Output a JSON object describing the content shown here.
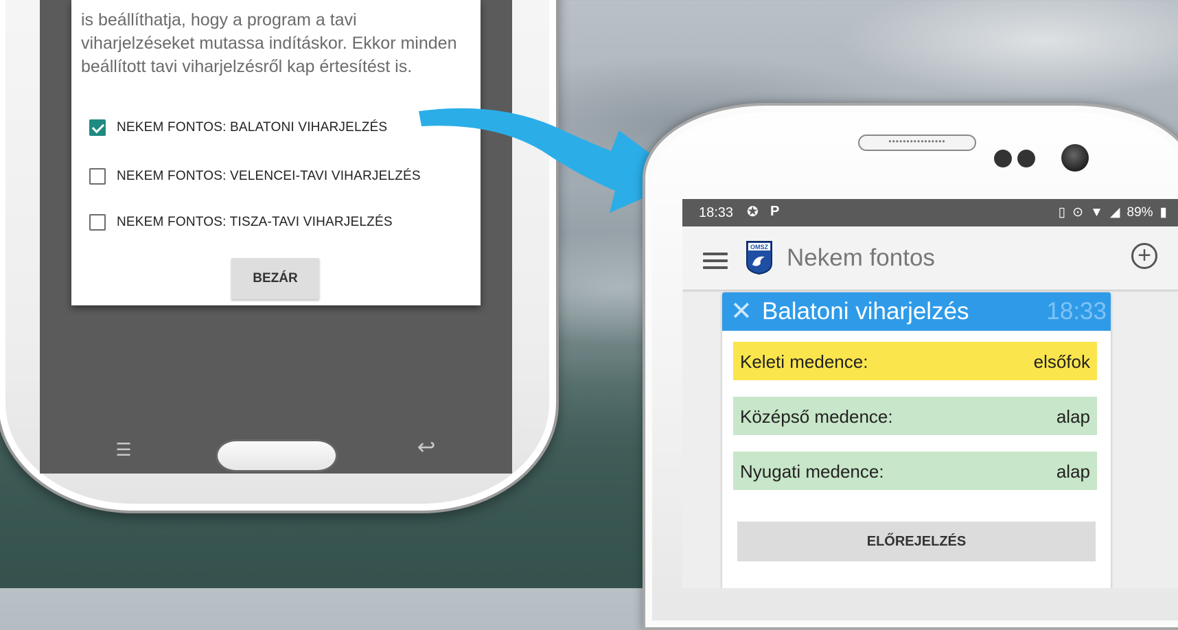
{
  "colors": {
    "checkbox_checked": "#1f8a82",
    "card_header": "#2f9be8",
    "card_time": "#7fc3f5",
    "arrow": "#2baee8",
    "row_warning": "#fbe54d",
    "row_basic": "#c8e6c9"
  },
  "left_phone": {
    "dialog_text": "is beállíthatja, hogy a program a tavi viharjelzéseket mutassa indításkor. Ekkor minden beállított tavi viharjelzésről kap értesítést is.",
    "options": [
      {
        "label": "NEKEM FONTOS: BALATONI VIHARJELZÉS",
        "checked": true
      },
      {
        "label": "NEKEM FONTOS: VELENCEI-TAVI VIHARJELZÉS",
        "checked": false
      },
      {
        "label": "NEKEM FONTOS: TISZA-TAVI VIHARJELZÉS",
        "checked": false
      }
    ],
    "close_label": "BEZÁR",
    "icons": {
      "menu_key": "menu-key-icon",
      "home_key": "home-button",
      "back_key": "back-key-icon"
    }
  },
  "right_phone": {
    "speaker_dots": "••••••••••••••••",
    "status_bar": {
      "time": "18:33",
      "icon_1": "notification-icon",
      "icon_2": "P",
      "battery": "89%",
      "right_icons": [
        "vibrate-icon",
        "location-icon",
        "wifi-icon",
        "signal-icon"
      ]
    },
    "app_bar": {
      "title": "Nekem fontos",
      "logo_text": "OMSZ",
      "icons": [
        "menu-icon",
        "omsz-logo",
        "add-circle-icon"
      ]
    },
    "card": {
      "close_glyph": "✕",
      "title": "Balatoni viharjelzés",
      "time": "18:33",
      "rows": [
        {
          "label": "Keleti medence:",
          "value": "elsőfok"
        },
        {
          "label": "Középső medence:",
          "value": "alap"
        },
        {
          "label": "Nyugati medence:",
          "value": "alap"
        }
      ],
      "forecast_label": "ELŐREJELZÉS"
    }
  }
}
